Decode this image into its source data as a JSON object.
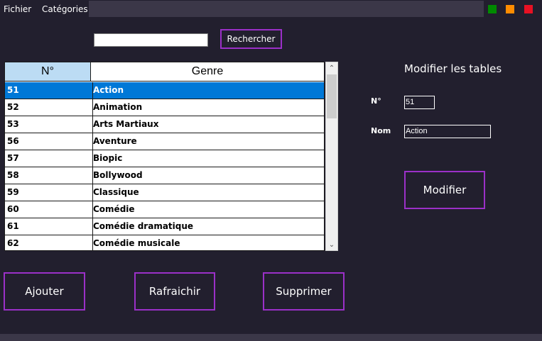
{
  "menu": {
    "file": "Fichier",
    "categories": "Catégories"
  },
  "window_buttons": {
    "green": "#008a00",
    "orange": "#ff8c00",
    "red": "#e81123"
  },
  "search": {
    "value": "",
    "button": "Rechercher"
  },
  "grid": {
    "headers": [
      "N°",
      "Genre"
    ],
    "rows": [
      {
        "id": "51",
        "genre": "Action",
        "selected": true
      },
      {
        "id": "52",
        "genre": "Animation"
      },
      {
        "id": "53",
        "genre": "Arts Martiaux"
      },
      {
        "id": "56",
        "genre": "Aventure"
      },
      {
        "id": "57",
        "genre": "Biopic"
      },
      {
        "id": "58",
        "genre": "Bollywood"
      },
      {
        "id": "59",
        "genre": "Classique"
      },
      {
        "id": "60",
        "genre": "Comédie"
      },
      {
        "id": "61",
        "genre": "Comédie dramatique"
      },
      {
        "id": "62",
        "genre": "Comédie musicale"
      }
    ]
  },
  "edit_panel": {
    "title": "Modifier les tables",
    "num_label": "N°",
    "num_value": "51",
    "name_label": "Nom",
    "name_value": "Action",
    "modify_button": "Modifier"
  },
  "actions": {
    "add": "Ajouter",
    "refresh": "Rafraichir",
    "delete": "Supprimer"
  },
  "colors": {
    "background": "#221f2e",
    "accent": "#9b30c8",
    "selection": "#0078d7",
    "header_highlight": "#bcdcf4"
  }
}
